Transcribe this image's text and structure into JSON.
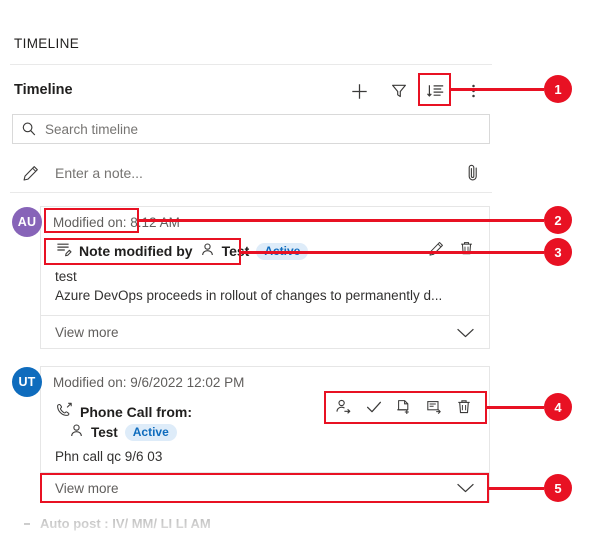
{
  "panel": {
    "section_title": "TIMELINE"
  },
  "toolbar": {
    "label": "Timeline",
    "add_label": "Add",
    "filter_label": "Filter",
    "sort_label": "Sort",
    "more_label": "More commands"
  },
  "search": {
    "placeholder": "Search timeline",
    "value": ""
  },
  "note_composer": {
    "placeholder": "Enter a note...",
    "value": "",
    "attach_label": "Attach file"
  },
  "entries": [
    {
      "avatar_initials": "AU",
      "avatar_color": "#8764b8",
      "modified_on": "Modified on: 8:12 AM",
      "record_title": "Note modified by",
      "person": "Test",
      "status": "Active",
      "body_line1": "test",
      "body_line2": "Azure DevOps proceeds in rollout of changes to permanently d...",
      "view_more": "View more",
      "actions": [
        "edit-icon",
        "delete-icon"
      ]
    },
    {
      "avatar_initials": "UT",
      "avatar_color": "#0f6cbd",
      "modified_on": "Modified on: 9/6/2022 12:02 PM",
      "record_title": "Phone Call from:",
      "person": "Test",
      "status": "Active",
      "body_line1": "Phn call qc 9/6 03",
      "view_more": "View more",
      "actions": [
        "assign-icon",
        "mark-complete-icon",
        "convert-to-case-icon",
        "open-record-icon",
        "delete-icon"
      ]
    }
  ],
  "cutoff_row": {
    "text": "Auto post : IV/ MM/ LI LI AM"
  },
  "annotations": {
    "accent_color": "#e81123",
    "callouts": [
      {
        "number": "1",
        "target": "sort-button"
      },
      {
        "number": "2",
        "target": "modified-on-label"
      },
      {
        "number": "3",
        "target": "record-title-row"
      },
      {
        "number": "4",
        "target": "phonecall-action-icons"
      },
      {
        "number": "5",
        "target": "view-more-bar"
      }
    ]
  }
}
